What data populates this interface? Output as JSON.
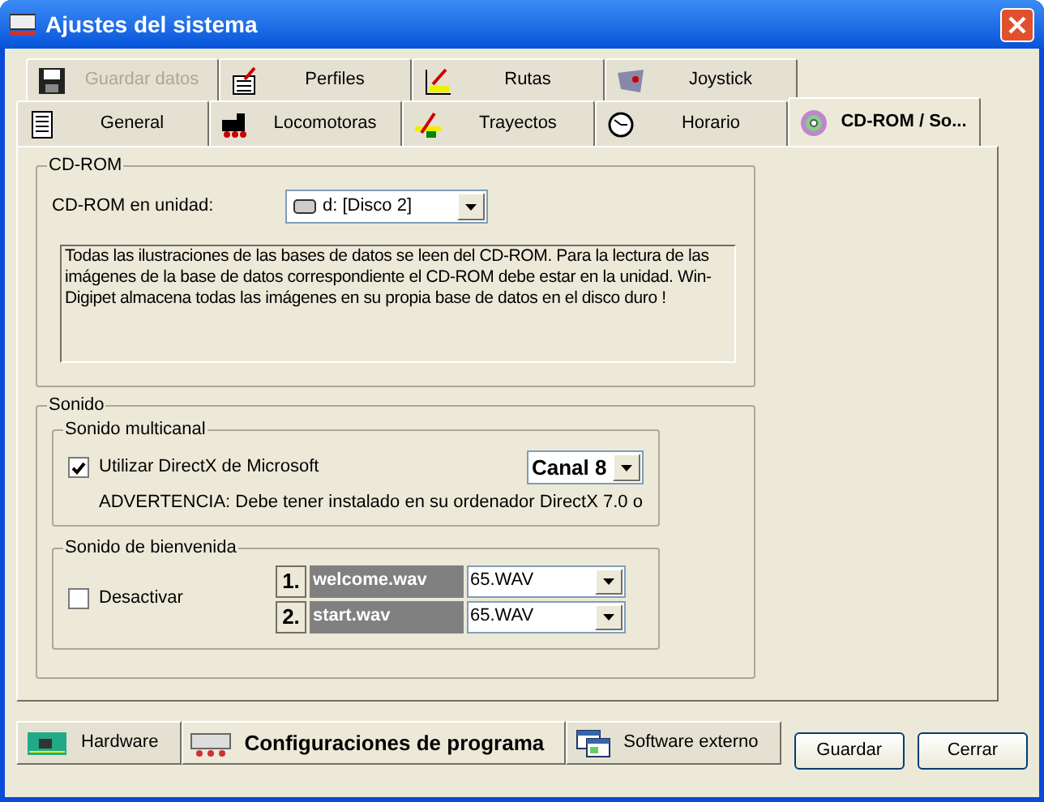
{
  "window": {
    "title": "Ajustes del sistema"
  },
  "tab_rows": [
    [
      {
        "label": "Guardar datos",
        "selected": false,
        "disabled": true
      },
      {
        "label": "Perfiles",
        "selected": false,
        "disabled": false
      },
      {
        "label": "Rutas",
        "selected": false,
        "disabled": false
      },
      {
        "label": "Joystick",
        "selected": false,
        "disabled": false
      }
    ],
    [
      {
        "label": "General",
        "selected": false,
        "disabled": false
      },
      {
        "label": "Locomotoras",
        "selected": false,
        "disabled": false
      },
      {
        "label": "Trayectos",
        "selected": false,
        "disabled": false
      },
      {
        "label": "Horario",
        "selected": false,
        "disabled": false
      },
      {
        "label": "CD-ROM / So...",
        "selected": true,
        "disabled": false
      }
    ]
  ],
  "cdrom": {
    "title": "CD-ROM",
    "drive_label": "CD-ROM en unidad:",
    "drive_value": "d: [Disco 2]",
    "info": "Todas las ilustraciones de las bases de datos se leen del CD-ROM.  Para la lectura de las imágenes de la base de datos correspondiente el CD-ROM debe estar en la unidad. Win-Digipet almacena todas las imágenes en su propia base de datos en el disco duro !"
  },
  "sonido": {
    "title": "Sonido",
    "multicanal": {
      "title": "Sonido multicanal",
      "directx_label": "Utilizar DirectX de Microsoft",
      "directx_checked": true,
      "channel": "Canal 8",
      "warning": "ADVERTENCIA: Debe tener instalado en su ordenador DirectX 7.0 o"
    },
    "bienvenida": {
      "title": "Sonido de bienvenida",
      "disable_label": "Desactivar",
      "disable_checked": false,
      "sounds": [
        {
          "number": "1.",
          "event": "welcome.wav",
          "file": "65.WAV"
        },
        {
          "number": "2.",
          "event": "start.wav",
          "file": "65.WAV"
        }
      ]
    }
  },
  "bottom_tabs": [
    {
      "label": "Hardware",
      "selected": false
    },
    {
      "label": "Configuraciones de programa",
      "selected": true
    },
    {
      "label": "Software externo",
      "selected": false
    }
  ],
  "buttons": [
    "Guardar",
    "Cerrar"
  ]
}
